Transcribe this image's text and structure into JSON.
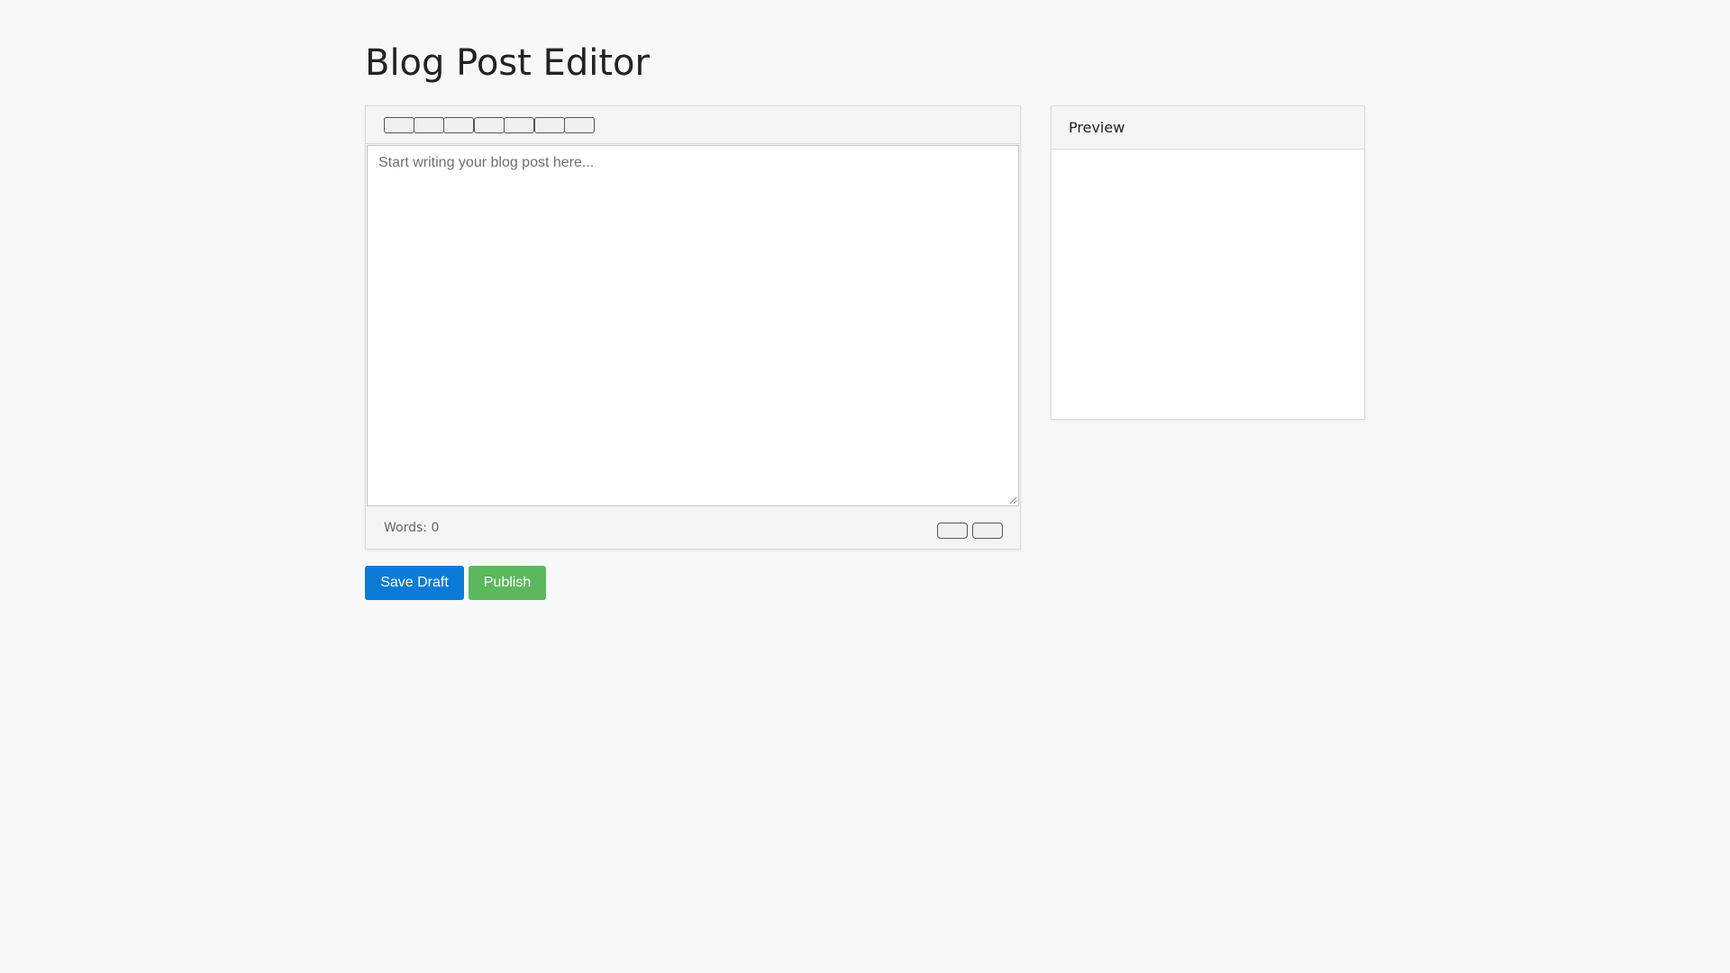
{
  "page": {
    "title": "Blog Post Editor"
  },
  "editor": {
    "toolbar_buttons": [
      "",
      "",
      "",
      "",
      "",
      "",
      ""
    ],
    "placeholder": "Start writing your blog post here...",
    "content": "",
    "word_count_label": "Words:",
    "word_count": "0",
    "footer_buttons": [
      "",
      ""
    ]
  },
  "preview": {
    "title": "Preview",
    "content": ""
  },
  "actions": {
    "save_draft_label": "Save Draft",
    "publish_label": "Publish"
  },
  "colors": {
    "background": "#f7f8f9",
    "save_button": "#0c7bd6",
    "publish_button": "#5cb85c"
  }
}
